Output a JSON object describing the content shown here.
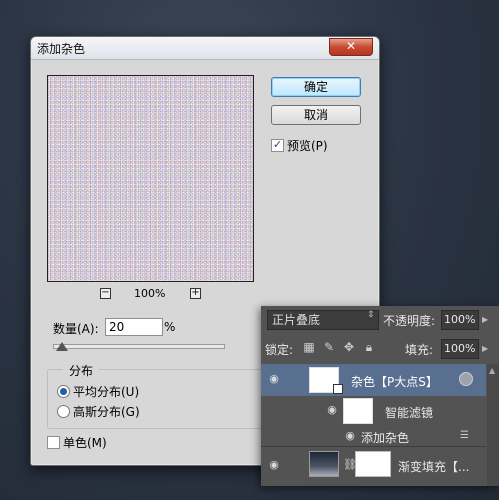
{
  "dialog": {
    "title": "添加杂色",
    "close_icon": "close-icon",
    "ok_label": "确定",
    "cancel_label": "取消",
    "preview_label": "预览(P)",
    "preview_checked": true,
    "zoom_level": "100%",
    "zoom_out_glyph": "−",
    "zoom_in_glyph": "+",
    "amount_label": "数量(A):",
    "amount_value": "20",
    "amount_unit": "%",
    "distribution_title": "分布",
    "distribution_options": [
      "平均分布(U)",
      "高斯分布(G)"
    ],
    "distribution_selected": "平均分布(U)",
    "monochrome_label": "单色(M)",
    "monochrome_checked": false
  },
  "layers_panel": {
    "blend_mode": "正片叠底",
    "opacity_label": "不透明度:",
    "opacity_value": "100%",
    "lock_label": "锁定:",
    "fill_label": "填充:",
    "fill_value": "100%",
    "layers": [
      {
        "name": "杂色【P大点S】",
        "selected": true,
        "visible": true
      },
      {
        "name": "智能滤镜",
        "visible": true
      },
      {
        "name": "添加杂色",
        "visible": true
      },
      {
        "name": "渐变填充【...",
        "visible": true
      }
    ],
    "colors": {
      "panel_bg": "#535353",
      "selected_row": "#596f90"
    }
  }
}
